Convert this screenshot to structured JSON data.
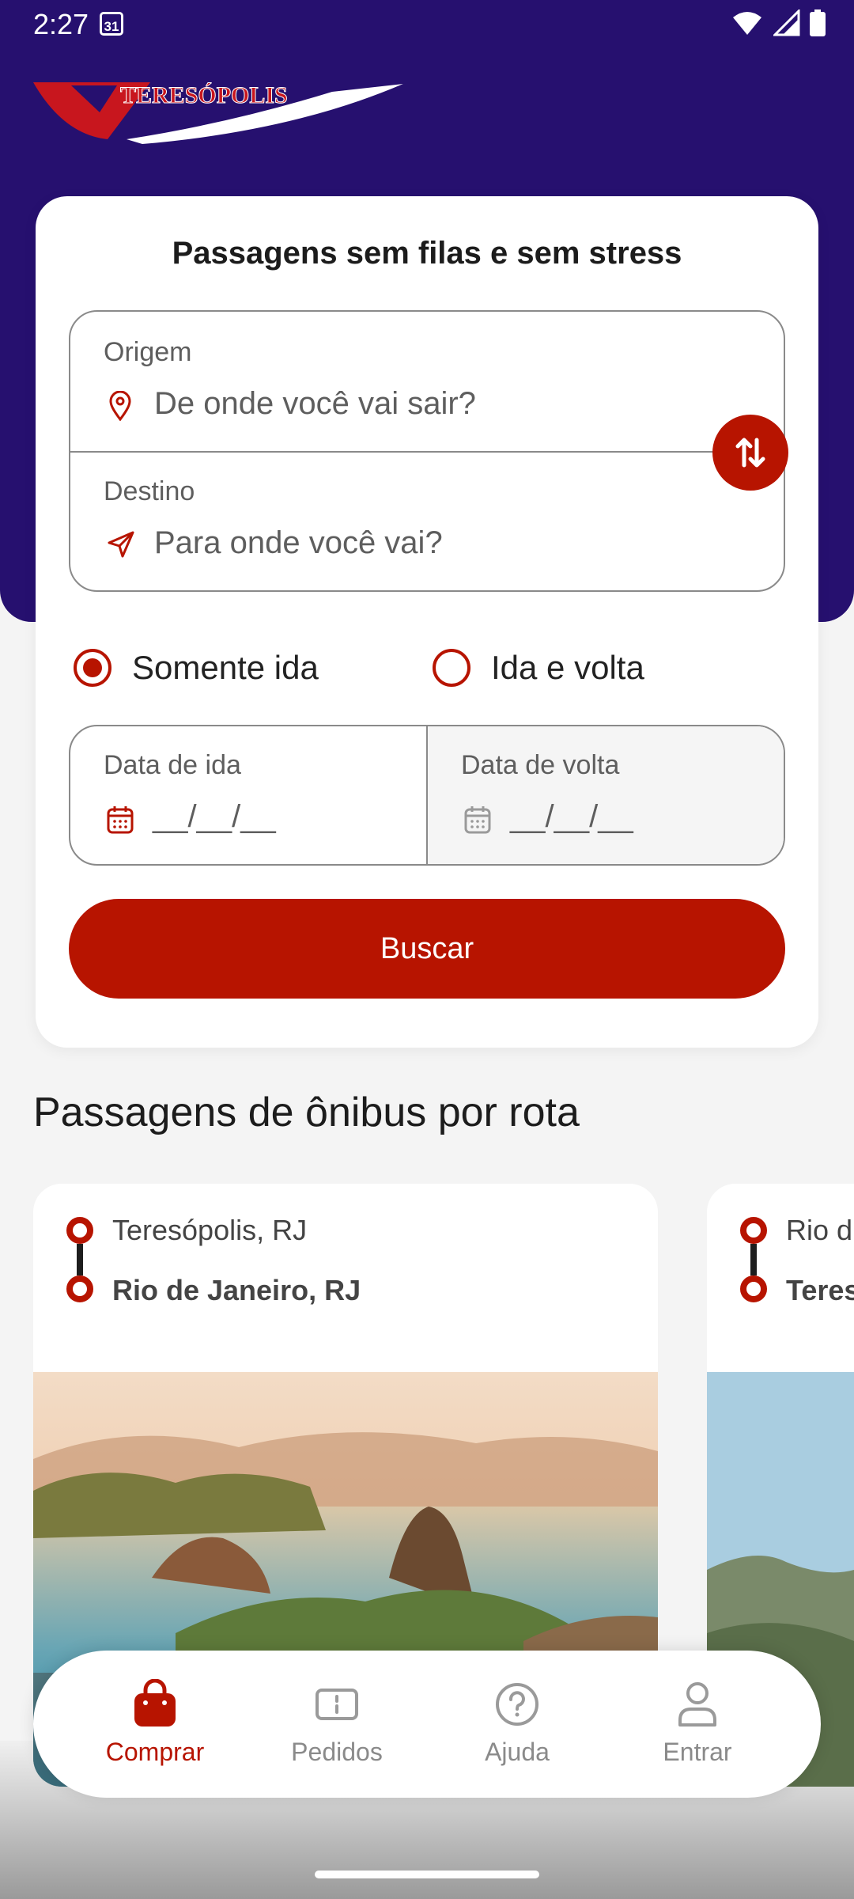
{
  "status_bar": {
    "time": "2:27",
    "calendar_day": "31"
  },
  "brand": {
    "name": "TERESÓPOLIS",
    "primary_color": "#26106f",
    "accent_color": "#b71400"
  },
  "search": {
    "title": "Passagens sem filas e sem stress",
    "origin_label": "Origem",
    "origin_placeholder": "De onde você vai sair?",
    "destination_label": "Destino",
    "destination_placeholder": "Para onde você vai?",
    "trip_types": [
      {
        "label": "Somente ida",
        "selected": true
      },
      {
        "label": "Ida e volta",
        "selected": false
      }
    ],
    "departure_label": "Data de ida",
    "departure_value": "__/__/__",
    "return_label": "Data de volta",
    "return_value": "__/__/__",
    "button_label": "Buscar"
  },
  "routes_section": {
    "title": "Passagens de ônibus por rota",
    "cards": [
      {
        "origin": "Teresópolis, RJ",
        "destination": "Rio de Janeiro, RJ"
      },
      {
        "origin": "Rio d",
        "destination": "Teres"
      }
    ]
  },
  "bottom_nav": {
    "items": [
      {
        "label": "Comprar",
        "icon": "shopping-bag-icon",
        "active": true
      },
      {
        "label": "Pedidos",
        "icon": "ticket-icon",
        "active": false
      },
      {
        "label": "Ajuda",
        "icon": "help-circle-icon",
        "active": false
      },
      {
        "label": "Entrar",
        "icon": "user-icon",
        "active": false
      }
    ]
  }
}
